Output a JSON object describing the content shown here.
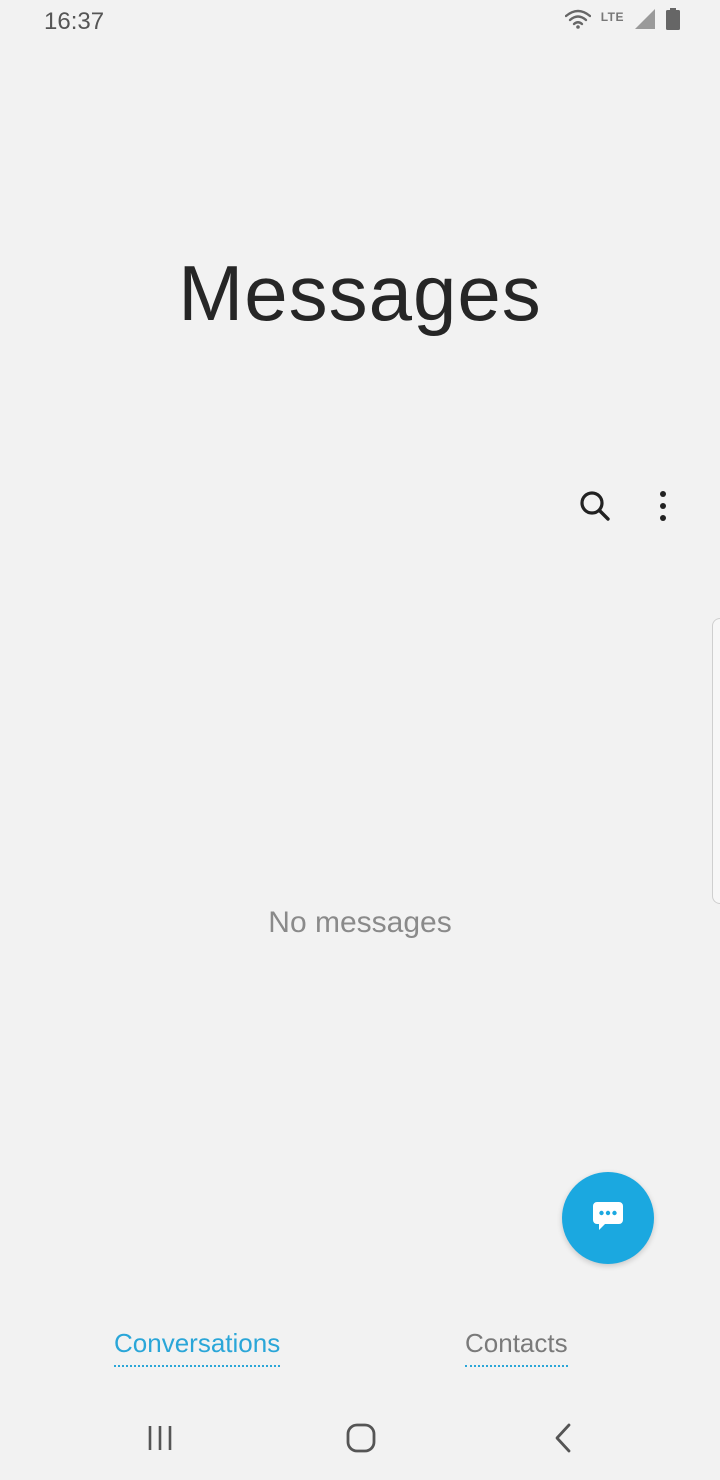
{
  "status_bar": {
    "time": "16:37",
    "network": "LTE",
    "icons": [
      "wifi-icon",
      "signal-icon",
      "battery-icon"
    ]
  },
  "header": {
    "title": "Messages"
  },
  "toolbar": {
    "search_icon": "search-icon",
    "more_icon": "more-options-icon"
  },
  "main": {
    "empty_text": "No messages"
  },
  "fab": {
    "icon": "compose-message-icon",
    "color": "#1ba8e0"
  },
  "tabs": [
    {
      "label": "Conversations",
      "active": true
    },
    {
      "label": "Contacts",
      "active": false
    }
  ],
  "nav_bar": {
    "icons": [
      "recent-apps-icon",
      "home-icon",
      "back-icon"
    ]
  },
  "colors": {
    "background": "#f2f2f2",
    "accent": "#2aa6d8",
    "fab": "#1ba8e0"
  }
}
